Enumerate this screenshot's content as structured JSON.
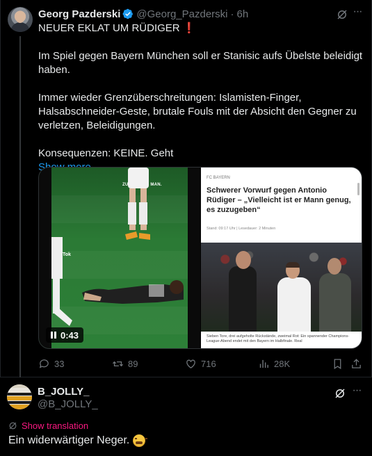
{
  "post": {
    "author_name": "Georg Pazderski",
    "handle": "@Georg_Pazderski",
    "separator": "·",
    "time": "6h",
    "verified": true,
    "lines": {
      "headline": "NEUER EKLAT UM RÜDIGER",
      "headline_mark": "❗",
      "p2": "Im Spiel gegen Bayern München soll er Stanisic aufs Übelste beleidigt haben.",
      "p3": "Immer wieder Grenzüberschreitungen: Islamisten-Finger, Halsabschneider-Geste, brutale Fouls mit der Absicht den Gegner zu verletzen, Beleidigungen.",
      "p4": "Konsequenzen: KEINE. Geht"
    },
    "show_more": "Show more",
    "video": {
      "duration": "0:43",
      "caption": "ZUGUHTING MAN.",
      "watermark": "TikTok"
    },
    "article": {
      "source": "FC BAYERN",
      "title": "Schwerer Vorwurf gegen Antonio Rüdiger – „Vielleicht ist er Mann genug, es zuzugeben“",
      "meta": "Stand: 09:17 Uhr | Lesedauer: 2 Minuten",
      "snippet": "Sieben Tore, drei aufgeholte Rückstände, zweimal Rot: Ein spannender Champions-League-Abend endet mit den Bayern im Halbfinale. Real"
    },
    "stats": {
      "replies": "33",
      "reposts": "89",
      "likes": "716",
      "views": "28K"
    }
  },
  "reply": {
    "author_name": "B_JOLLY_",
    "handle": "@B_JOLLY_",
    "translate_label": "Show translation",
    "text": "Ein widerwärtiger Neger."
  },
  "colors": {
    "background": "#000000",
    "text": "#e7e9ea",
    "muted": "#71767b",
    "link": "#1d9bf0",
    "translate": "#f91880",
    "verified": "#1d9bf0",
    "alert": "#f4212e"
  },
  "icons": [
    "verified-badge-icon",
    "grok-icon",
    "more-icon",
    "pause-icon",
    "reply-icon",
    "repost-icon",
    "like-icon",
    "views-icon",
    "bookmark-icon",
    "share-icon",
    "translate-icon",
    "weary-face-emoji"
  ]
}
